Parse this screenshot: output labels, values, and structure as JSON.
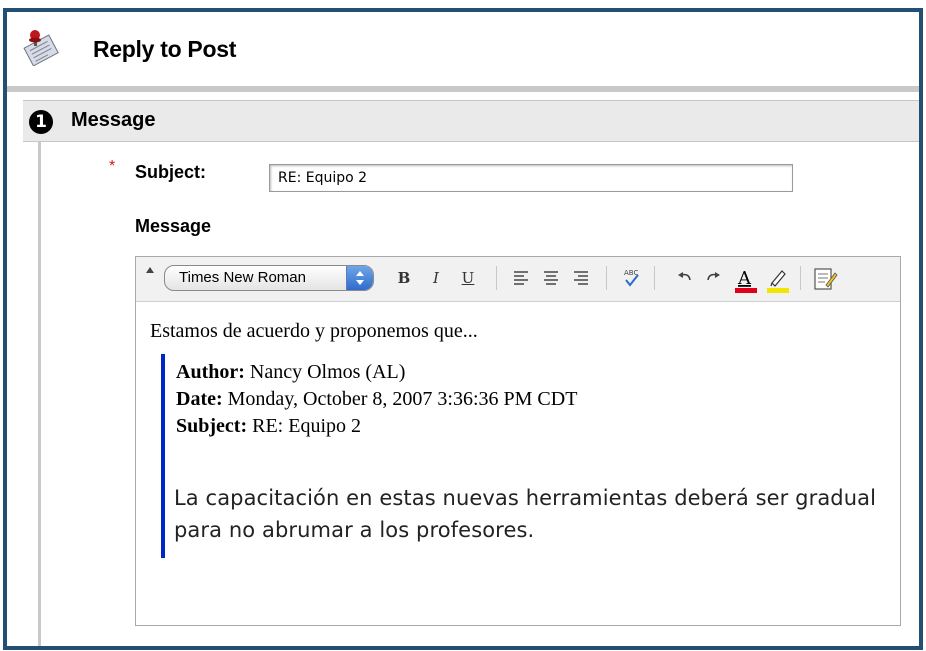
{
  "header": {
    "title": "Reply to Post",
    "icon": "discussion-post-pushpin-icon"
  },
  "section": {
    "step": "1",
    "title": "Message"
  },
  "form": {
    "required_marker": "*",
    "subject_label": "Subject:",
    "subject_value": "RE: Equipo 2",
    "message_label": "Message"
  },
  "toolbar": {
    "font": "Times New Roman",
    "bold_label": "B",
    "italic_label": "I",
    "underline_label": "U",
    "text_color": "#e0001b",
    "highlight_color": "#f2e600"
  },
  "editor": {
    "lead": "Estamos de acuerdo y proponemos que...",
    "quote": {
      "author_label": "Author:",
      "author_value": "Nancy Olmos (AL)",
      "date_label": "Date:",
      "date_value": "Monday, October 8, 2007 3:36:36 PM CDT",
      "subject_label": "Subject:",
      "subject_value": "RE: Equipo 2",
      "body": "La capacitación en estas nuevas herramientas deberá ser gradual para no abrumar a los profesores.",
      "bar_color": "#0026c8"
    }
  },
  "colors": {
    "frame_border": "#244f75",
    "section_bar": "#eaeaea",
    "required": "#d0161b"
  }
}
